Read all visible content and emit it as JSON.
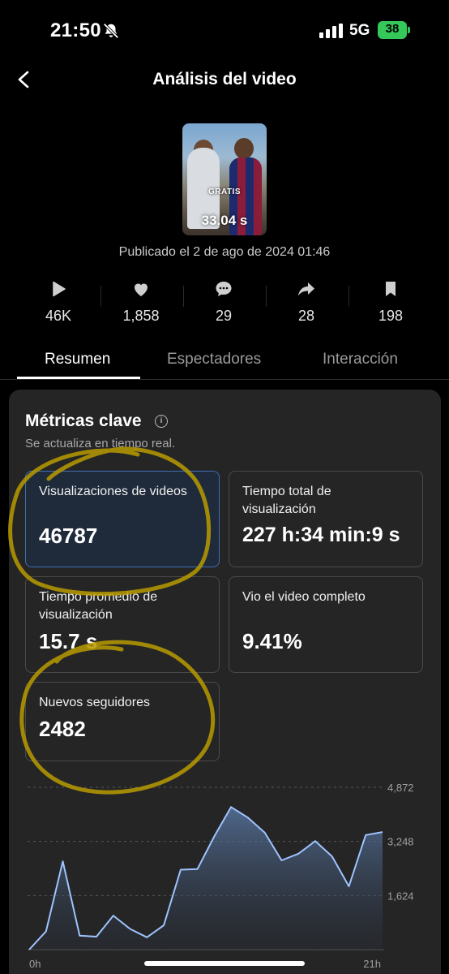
{
  "status_bar": {
    "time": "21:50",
    "network": "5G",
    "battery": "38"
  },
  "header": {
    "title": "Análisis del video"
  },
  "video": {
    "overlay_text": "GRATIS",
    "duration": "33.04 s",
    "published": "Publicado el 2 de ago de 2024 01:46"
  },
  "stats": [
    {
      "icon": "play-icon",
      "value": "46K"
    },
    {
      "icon": "heart-icon",
      "value": "1,858"
    },
    {
      "icon": "comment-icon",
      "value": "29"
    },
    {
      "icon": "share-icon",
      "value": "28"
    },
    {
      "icon": "bookmark-icon",
      "value": "198"
    }
  ],
  "tabs": [
    {
      "label": "Resumen",
      "active": true
    },
    {
      "label": "Espectadores",
      "active": false
    },
    {
      "label": "Interacción",
      "active": false
    }
  ],
  "key_metrics": {
    "title": "Métricas clave",
    "subtitle": "Se actualiza en tiempo real.",
    "cards": [
      {
        "label": "Visualizaciones de videos",
        "value": "46787",
        "selected": true
      },
      {
        "label": "Tiempo total de visualización",
        "value": "227 h:34 min:9 s",
        "selected": false
      },
      {
        "label": "Tiempo promedio de visualización",
        "value": "15.7 s",
        "selected": false
      },
      {
        "label": "Vio el video completo",
        "value": "9.41%",
        "selected": false
      },
      {
        "label": "Nuevos seguidores",
        "value": "2482",
        "selected": false
      }
    ]
  },
  "chart_data": {
    "type": "area",
    "y_ticks": [
      "4,872",
      "3,248",
      "1,624"
    ],
    "x_ticks": [
      "0h",
      "21h"
    ],
    "ylim": [
      0,
      4872
    ],
    "x": [
      0,
      1,
      2,
      3,
      4,
      5,
      6,
      7,
      8,
      9,
      10,
      11,
      12,
      13,
      14,
      15,
      16,
      17,
      18,
      19,
      20,
      21
    ],
    "values": [
      0,
      550,
      2650,
      420,
      390,
      1020,
      620,
      370,
      730,
      2400,
      2420,
      3400,
      4280,
      3960,
      3510,
      2680,
      2880,
      3260,
      2800,
      1900,
      3440,
      3530
    ],
    "colors": {
      "line": "#9ec4ff",
      "fill_top": "#5e7fae",
      "grid": "#555555"
    }
  },
  "colors": {
    "accent": "#3f6fb5",
    "annotation": "#c9a800"
  }
}
